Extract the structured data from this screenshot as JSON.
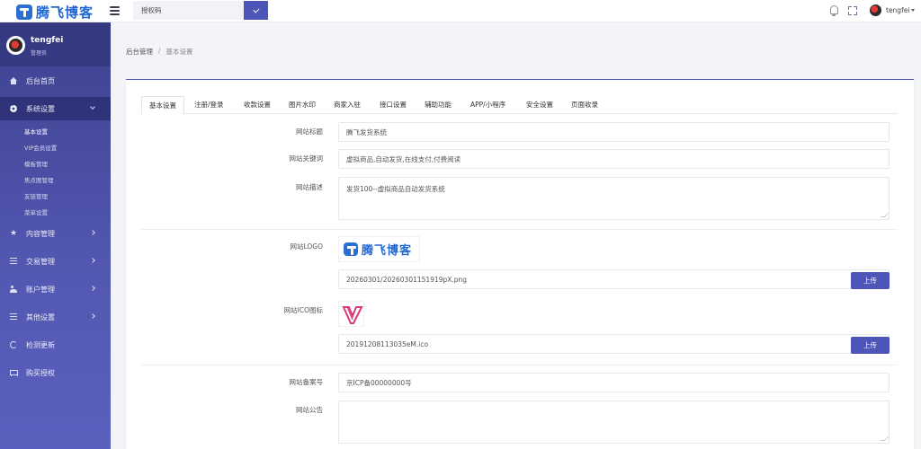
{
  "brand": {
    "name": "腾飞博客"
  },
  "search": {
    "placeholder": "授权码"
  },
  "user": {
    "name": "tengfei",
    "role": "管理员"
  },
  "sidebar": {
    "items": [
      {
        "label": "后台首页"
      },
      {
        "label": "系统设置"
      },
      {
        "label": "内容管理"
      },
      {
        "label": "交易管理"
      },
      {
        "label": "账户管理"
      },
      {
        "label": "其他设置"
      },
      {
        "label": "检测更新"
      },
      {
        "label": "购买授权"
      }
    ],
    "subitems": [
      {
        "label": "基本设置"
      },
      {
        "label": "VIP会员设置"
      },
      {
        "label": "模板管理"
      },
      {
        "label": "焦点图管理"
      },
      {
        "label": "友链管理"
      },
      {
        "label": "菜单设置"
      }
    ]
  },
  "breadcrumb": {
    "root": "后台管理",
    "separator": "/",
    "current": "基本设置"
  },
  "tabs": [
    {
      "label": "基本设置"
    },
    {
      "label": "注册/登录"
    },
    {
      "label": "收款设置"
    },
    {
      "label": "图片水印"
    },
    {
      "label": "商家入驻"
    },
    {
      "label": "接口设置"
    },
    {
      "label": "辅助功能"
    },
    {
      "label": "APP/小程序"
    },
    {
      "label": "安全设置"
    },
    {
      "label": "页面收录"
    }
  ],
  "form": {
    "site_title": {
      "label": "网站标题",
      "value": "腾飞发货系统"
    },
    "site_keywords": {
      "label": "网站关键词",
      "value": "虚拟商品,自动发货,在线支付,付费阅读"
    },
    "site_description": {
      "label": "网站描述",
      "value": "发货100--虚拟商品自动发货系统"
    },
    "site_logo": {
      "label": "网站LOGO",
      "value": "20260301/20260301151919pX.png",
      "preview_text": "腾飞博客"
    },
    "site_ico": {
      "label": "网站ICO图标",
      "value": "20191208113035eM.ico"
    },
    "icp": {
      "label": "网站备案号",
      "value": "京ICP备00000000号"
    },
    "notice": {
      "label": "网站公告",
      "value": ""
    },
    "upload_label": "上传"
  },
  "colors": {
    "primary": "#4e55b8",
    "sidebar": "#4a4fa3",
    "brand": "#1d66d6",
    "ico": "#d63a7a"
  }
}
